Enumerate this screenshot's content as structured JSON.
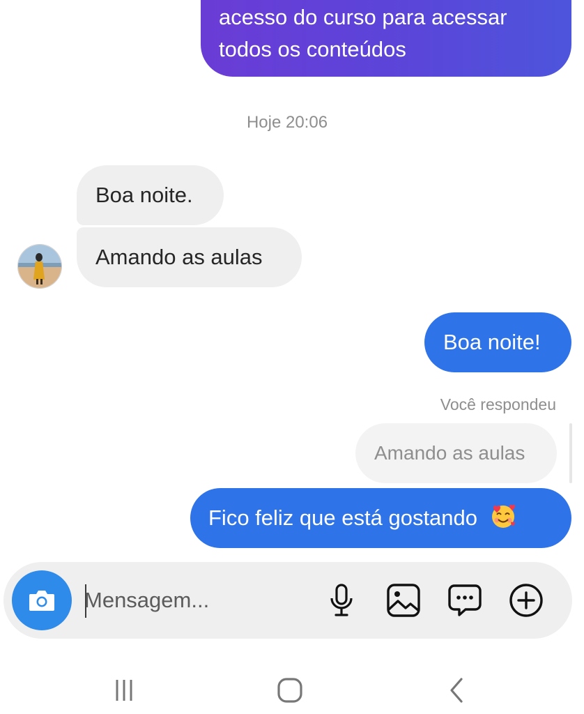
{
  "thread": {
    "top_message_lines": [
      "acesso do curso para acessar",
      "todos os conteúdos"
    ],
    "timestamp": "Hoje 20:06",
    "received": [
      {
        "text": "Boa noite."
      },
      {
        "text": "Amando as aulas"
      }
    ],
    "sent_reply": "Boa noite!",
    "reply_label": "Você respondeu",
    "quoted_message": "Amando as aulas",
    "last_message": "Fico feliz que está gostando"
  },
  "composer": {
    "placeholder": "Mensagem...",
    "value": ""
  },
  "icons": {
    "camera": "camera-icon",
    "mic": "microphone-icon",
    "gallery": "gallery-icon",
    "sticker": "sticker-chat-icon",
    "plus": "plus-circle-icon",
    "emoji": "smiling-face-with-hearts-emoji",
    "nav_recent": "recent-apps-icon",
    "nav_home": "home-icon",
    "nav_back": "back-icon"
  },
  "colors": {
    "sent_bubble": "#2f73e8",
    "purple_bubble_start": "#6a3cd6",
    "purple_bubble_end": "#4d55dc",
    "received_bubble": "#efefef",
    "camera_button": "#2f8bea",
    "muted_text": "#8e8e8e"
  }
}
